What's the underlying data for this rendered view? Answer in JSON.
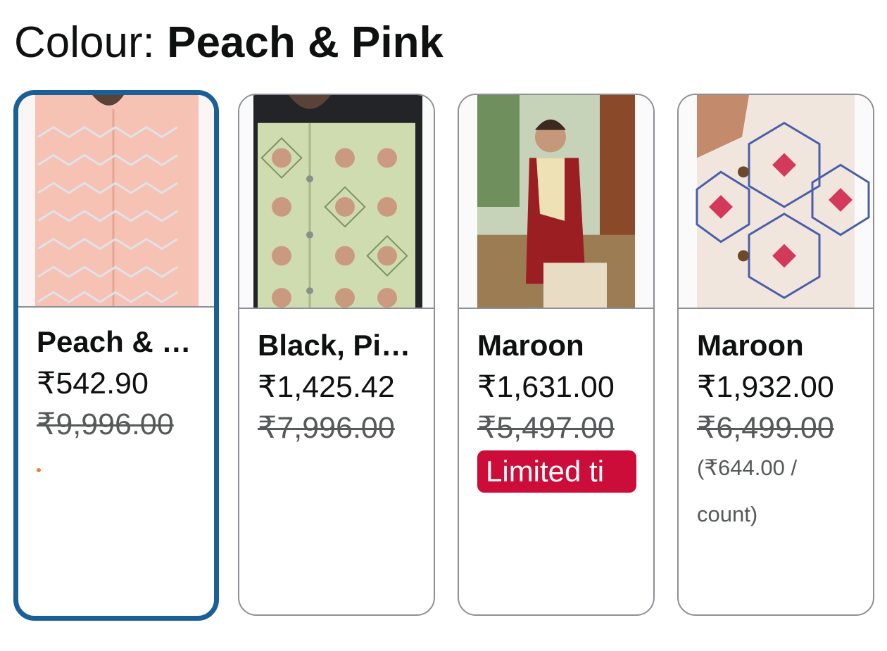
{
  "header": {
    "label": "Colour: ",
    "value": "Peach & Pink"
  },
  "variants": [
    {
      "title": "Peach & Pink",
      "price": "₹542.90",
      "mrp": "₹9,996.00",
      "selected": true,
      "garment_color": "#f6c2b4"
    },
    {
      "title": "Black, Pista Green",
      "price": "₹1,425.42",
      "mrp": "₹7,996.00",
      "selected": false,
      "garment_color": "#cfdcb0"
    },
    {
      "title": "Maroon",
      "price": "₹1,631.00",
      "mrp": "₹5,497.00",
      "deal_badge": "Limited ti",
      "selected": false,
      "garment_color": "#9b1e22"
    },
    {
      "title": "Maroon",
      "price": "₹1,932.00",
      "mrp": "₹6,499.00",
      "unit_price": "(₹644.00 / count)",
      "selected": false,
      "garment_color": "#f1e6de"
    }
  ],
  "colors": {
    "selected_border": "#1a5f96",
    "card_border": "#8d9096",
    "deal_badge": "#cc0c39",
    "muted_text": "#565959"
  }
}
